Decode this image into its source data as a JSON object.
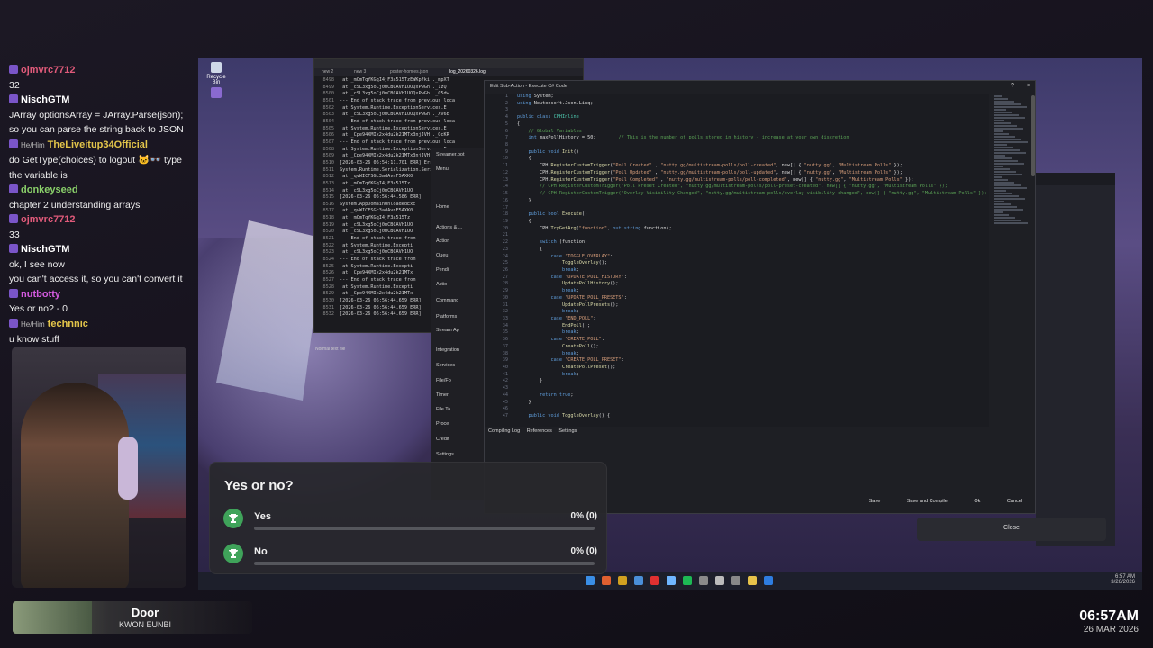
{
  "chat": [
    {
      "user": "ojmvrc7712",
      "color": "#e05a7a",
      "pron": "",
      "msg": "32"
    },
    {
      "user": "NischGTM",
      "color": "#ffffff",
      "pron": "",
      "msg": "JArray optionsArray = JArray.Parse(json);"
    },
    {
      "user": "",
      "color": "",
      "pron": "",
      "msg": "so you can parse the string back to JSON"
    },
    {
      "user": "TheLiveitup34Official",
      "color": "#e3c54a",
      "pron": "He/Him",
      "msg": "do GetType(choices) to logout 🐱‍👓 type"
    },
    {
      "user": "",
      "color": "",
      "pron": "",
      "msg": "the variable is"
    },
    {
      "user": "donkeyseed",
      "color": "#8ad06a",
      "pron": "",
      "msg": "chapter 2 understanding arrays"
    },
    {
      "user": "ojmvrc7712",
      "color": "#e05a7a",
      "pron": "",
      "msg": "33"
    },
    {
      "user": "NischGTM",
      "color": "#ffffff",
      "pron": "",
      "msg": "ok, I see now"
    },
    {
      "user": "",
      "color": "",
      "pron": "",
      "msg": "you can't access it, so you can't convert it"
    },
    {
      "user": "nutbotty",
      "color": "#d35adf",
      "pron": "",
      "msg": "Yes or no? - 0"
    },
    {
      "user": "technnic",
      "color": "#e3c54a",
      "pron": "He/Him",
      "msg": "u know stuff"
    }
  ],
  "now_playing": {
    "title": "Door",
    "artist": "KWON EUNBI"
  },
  "clock": {
    "time": "06:57AM",
    "date": "26 MAR 2026"
  },
  "desktop": {
    "recycle_bin": "Recycle Bin"
  },
  "log": {
    "tabs": [
      "new 2",
      "new 3",
      "poster-homies.json",
      "log_20260326.log"
    ],
    "lines": [
      [
        "8498",
        "   at _mOmTqYKGqI4jF3a515TzEWKpfki.._mpXT"
      ],
      [
        "8499",
        "   at _cSL3xg5oCj0mCBCAVh1UOQxPwGh.._1zQ"
      ],
      [
        "8500",
        "   at _cSL3xg5oCj0mCBCAVh1UOQxPwGh.._C5dw"
      ],
      [
        "8501",
        "--- End of stack trace from previous loca"
      ],
      [
        "8502",
        "   at System.Runtime.ExceptionServices.E"
      ],
      [
        "8503",
        "   at _cSL3xg5oCj0mCBCAVh1UOQxPwGh.._Xv6b"
      ],
      [
        "8504",
        "--- End of stack trace from previous loca"
      ],
      [
        "8505",
        "   at System.Runtime.ExceptionServices.E"
      ],
      [
        "8506",
        "   at _Cpe94XMIx2x4du2k21MTx3njJVH.._QcKR"
      ],
      [
        "8507",
        "--- End of stack trace from previous loca"
      ],
      [
        "8508",
        "   at System.Runtime.ExceptionServices.E"
      ],
      [
        "8509",
        "   at _Cpe94XMIx2x4du2k21MTx3njJVH.._QcKR"
      ],
      [
        "8510",
        "[2026-03-26 06:54:11.701 ERR] Error comp"
      ],
      [
        "8511",
        "System.Runtime.Serialization.Serialization"
      ],
      [
        "8512",
        "   at _qvWICFSGc3adAvnF5AXK0"
      ],
      [
        "8513",
        "   at _mOmTqYKGqI4jF3a515Tz"
      ],
      [
        "8514",
        "   at _cSL3xg5oCj0mCBCAVh1UO"
      ],
      [
        "8515",
        "[2026-03-26 06:56:44.586 ERR]"
      ],
      [
        "8516",
        "System.AppDomainUnloadedExc"
      ],
      [
        "8517",
        "   at _qvWICFSGc3adAvnF5AXK0"
      ],
      [
        "8518",
        "   at _mOmTqYKGqI4jF3a515Tz"
      ],
      [
        "8519",
        "   at _cSL3xg5oCj0mCBCAVh1UO"
      ],
      [
        "8520",
        "   at _cSL3xg5oCj0mCBCAVh1UO"
      ],
      [
        "8521",
        "--- End of stack trace from"
      ],
      [
        "8522",
        "   at System.Runtime.Excepti"
      ],
      [
        "8523",
        "   at _cSL3xg5oCj0mCBCAVh1UO"
      ],
      [
        "8524",
        "--- End of stack trace from"
      ],
      [
        "8525",
        "   at System.Runtime.Excepti"
      ],
      [
        "8526",
        "   at _Cpe94XMIx2x4du2k21MTx"
      ],
      [
        "8527",
        "--- End of stack trace from"
      ],
      [
        "8528",
        "   at System.Runtime.Excepti"
      ],
      [
        "8529",
        "   at _Cpe94XMIx2x4du2k21MTx"
      ],
      [
        "8530",
        "[2026-03-26 06:56:44.659 ERR]"
      ],
      [
        "8531",
        "[2026-03-26 06:56:44.659 ERR]"
      ],
      [
        "8532",
        "[2026-03-26 06:56:44.659 ERR]"
      ]
    ],
    "footer": "Normal text file"
  },
  "sbot": {
    "title": "Streamer.bot",
    "menu": "Menu",
    "items": [
      "Home",
      "Actions & ...",
      "Action",
      "Queu",
      "Pendi",
      "Actio",
      "Command",
      "Platforms",
      "Stream Ap",
      "Integration",
      "Services",
      "File/Fo",
      "Timer",
      "File Ta",
      "Proce",
      "Credit",
      "Settings"
    ]
  },
  "dialog": {
    "title": "Edit Sub-Action - Execute C# Code",
    "help": "?",
    "close": "×",
    "tabs": [
      "Compiling Log",
      "References",
      "Settings"
    ],
    "buttons": [
      "Save",
      "Save and Compile",
      "Ok",
      "Cancel"
    ]
  },
  "code": [
    [
      "1",
      [
        [
          "kw",
          "using "
        ],
        [
          "",
          "System;"
        ]
      ]
    ],
    [
      "2",
      [
        [
          "kw",
          "using "
        ],
        [
          "",
          "Newtonsoft.Json.Linq;"
        ]
      ]
    ],
    [
      "3",
      []
    ],
    [
      "4",
      [
        [
          "kw",
          "public class "
        ],
        [
          "ty",
          "CPHInline"
        ]
      ]
    ],
    [
      "5",
      [
        [
          "",
          "{"
        ]
      ]
    ],
    [
      "6",
      [
        [
          "cmt",
          "    // Global Variables"
        ]
      ]
    ],
    [
      "7",
      [
        [
          "kw",
          "    int "
        ],
        [
          "",
          "maxPollHistory = 50;"
        ],
        [
          "cmt",
          "        // This is the number of polls stored in history - increase at your own discretion"
        ]
      ]
    ],
    [
      "8",
      []
    ],
    [
      "9",
      [
        [
          "kw",
          "    public void "
        ],
        [
          "fn",
          "Init"
        ],
        [
          "",
          "()"
        ]
      ]
    ],
    [
      "10",
      [
        [
          "",
          "    {"
        ]
      ]
    ],
    [
      "11",
      [
        [
          "",
          "        CPH."
        ],
        [
          "fn",
          "RegisterCustomTrigger"
        ],
        [
          "",
          "("
        ],
        [
          "str",
          "\"Poll Created\""
        ],
        [
          "",
          " , "
        ],
        [
          "str",
          "\"nutty.gg/multistream-polls/poll-created\""
        ],
        [
          "",
          ", new[] { "
        ],
        [
          "str",
          "\"nutty.gg\""
        ],
        [
          "",
          ", "
        ],
        [
          "str",
          "\"Multistream Polls\""
        ],
        [
          "",
          " });"
        ]
      ]
    ],
    [
      "12",
      [
        [
          "",
          "        CPH."
        ],
        [
          "fn",
          "RegisterCustomTrigger"
        ],
        [
          "",
          "("
        ],
        [
          "str",
          "\"Poll Updated\""
        ],
        [
          "",
          " , "
        ],
        [
          "str",
          "\"nutty.gg/multistream-polls/poll-updated\""
        ],
        [
          "",
          ", new[] { "
        ],
        [
          "str",
          "\"nutty.gg\""
        ],
        [
          "",
          ", "
        ],
        [
          "str",
          "\"Multistream Polls\""
        ],
        [
          "",
          " });"
        ]
      ]
    ],
    [
      "13",
      [
        [
          "",
          "        CPH."
        ],
        [
          "fn",
          "RegisterCustomTrigger"
        ],
        [
          "",
          "("
        ],
        [
          "str",
          "\"Poll Completed\""
        ],
        [
          "",
          " , "
        ],
        [
          "str",
          "\"nutty.gg/multistream-polls/poll-completed\""
        ],
        [
          "",
          ", new[] { "
        ],
        [
          "str",
          "\"nutty.gg\""
        ],
        [
          "",
          ", "
        ],
        [
          "str",
          "\"Multistream Polls\""
        ],
        [
          "",
          " });"
        ]
      ]
    ],
    [
      "14",
      [
        [
          "cmt",
          "        // CPH.RegisterCustomTrigger(\"Poll Preset Created\", \"nutty.gg/multistream-polls/poll-preset-created\", new[] { \"nutty.gg\", \"Multistream Polls\" });"
        ]
      ]
    ],
    [
      "15",
      [
        [
          "cmt",
          "        // CPH.RegisterCustomTrigger(\"Overlay Visibility Changed\", \"nutty.gg/multistream-polls/overlay-visibility-changed\", new[] { \"nutty.gg\", \"Multistream Polls\" });"
        ]
      ]
    ],
    [
      "16",
      [
        [
          "",
          "    }"
        ]
      ]
    ],
    [
      "17",
      []
    ],
    [
      "18",
      [
        [
          "kw",
          "    public bool "
        ],
        [
          "fn",
          "Execute"
        ],
        [
          "",
          "()"
        ]
      ]
    ],
    [
      "19",
      [
        [
          "",
          "    {"
        ]
      ]
    ],
    [
      "20",
      [
        [
          "",
          "        CPH."
        ],
        [
          "fn",
          "TryGetArg"
        ],
        [
          "",
          "("
        ],
        [
          "str",
          "\"function\""
        ],
        [
          "",
          ", "
        ],
        [
          "kw",
          "out string "
        ],
        [
          "",
          "function);"
        ]
      ]
    ],
    [
      "21",
      []
    ],
    [
      "22",
      [
        [
          "kw",
          "        switch "
        ],
        [
          "",
          "(function)"
        ]
      ]
    ],
    [
      "23",
      [
        [
          "",
          "        {"
        ]
      ]
    ],
    [
      "24",
      [
        [
          "kw",
          "            case "
        ],
        [
          "str",
          "\"TOGGLE_OVERLAY\""
        ],
        [
          "",
          ":"
        ]
      ]
    ],
    [
      "25",
      [
        [
          "fn",
          "                ToggleOverlay"
        ],
        [
          "",
          "();"
        ]
      ]
    ],
    [
      "26",
      [
        [
          "kw",
          "                break"
        ],
        [
          "",
          ";"
        ]
      ]
    ],
    [
      "27",
      [
        [
          "kw",
          "            case "
        ],
        [
          "str",
          "\"UPDATE_POLL_HISTORY\""
        ],
        [
          "",
          ":"
        ]
      ]
    ],
    [
      "28",
      [
        [
          "fn",
          "                UpdatePollHistory"
        ],
        [
          "",
          "();"
        ]
      ]
    ],
    [
      "29",
      [
        [
          "kw",
          "                break"
        ],
        [
          "",
          ";"
        ]
      ]
    ],
    [
      "30",
      [
        [
          "kw",
          "            case "
        ],
        [
          "str",
          "\"UPDATE_POLL_PRESETS\""
        ],
        [
          "",
          ":"
        ]
      ]
    ],
    [
      "31",
      [
        [
          "fn",
          "                UpdatePollPresets"
        ],
        [
          "",
          "();"
        ]
      ]
    ],
    [
      "32",
      [
        [
          "kw",
          "                break"
        ],
        [
          "",
          ";"
        ]
      ]
    ],
    [
      "33",
      [
        [
          "kw",
          "            case "
        ],
        [
          "str",
          "\"END_POLL\""
        ],
        [
          "",
          ":"
        ]
      ]
    ],
    [
      "34",
      [
        [
          "fn",
          "                EndPoll"
        ],
        [
          "",
          "();"
        ]
      ]
    ],
    [
      "35",
      [
        [
          "kw",
          "                break"
        ],
        [
          "",
          ";"
        ]
      ]
    ],
    [
      "36",
      [
        [
          "kw",
          "            case "
        ],
        [
          "str",
          "\"CREATE_POLL\""
        ],
        [
          "",
          ":"
        ]
      ]
    ],
    [
      "37",
      [
        [
          "fn",
          "                CreatePoll"
        ],
        [
          "",
          "();"
        ]
      ]
    ],
    [
      "38",
      [
        [
          "kw",
          "                break"
        ],
        [
          "",
          ";"
        ]
      ]
    ],
    [
      "39",
      [
        [
          "kw",
          "            case "
        ],
        [
          "str",
          "\"CREATE_POLL_PRESET\""
        ],
        [
          "",
          ":"
        ]
      ]
    ],
    [
      "40",
      [
        [
          "fn",
          "                CreatePollPreset"
        ],
        [
          "",
          "();"
        ]
      ]
    ],
    [
      "41",
      [
        [
          "kw",
          "                break"
        ],
        [
          "",
          ";"
        ]
      ]
    ],
    [
      "42",
      [
        [
          "",
          "        }"
        ]
      ]
    ],
    [
      "43",
      []
    ],
    [
      "44",
      [
        [
          "kw",
          "        return true"
        ],
        [
          "",
          ";"
        ]
      ]
    ],
    [
      "45",
      [
        [
          "",
          "    }"
        ]
      ]
    ],
    [
      "46",
      []
    ],
    [
      "47",
      [
        [
          "kw",
          "    public void "
        ],
        [
          "fn",
          "ToggleOverlay"
        ],
        [
          "",
          "() {"
        ]
      ]
    ]
  ],
  "poll": {
    "title": "Yes or no?",
    "accent": "#3fa35a",
    "options": [
      {
        "label": "Yes",
        "pct_text": "0% (0)",
        "fraction": 0
      },
      {
        "label": "No",
        "pct_text": "0% (0)",
        "fraction": 0
      }
    ]
  },
  "right_panel": {
    "pct1": "0% (0)",
    "pct2": "0% (0)",
    "close": "Close"
  }
}
